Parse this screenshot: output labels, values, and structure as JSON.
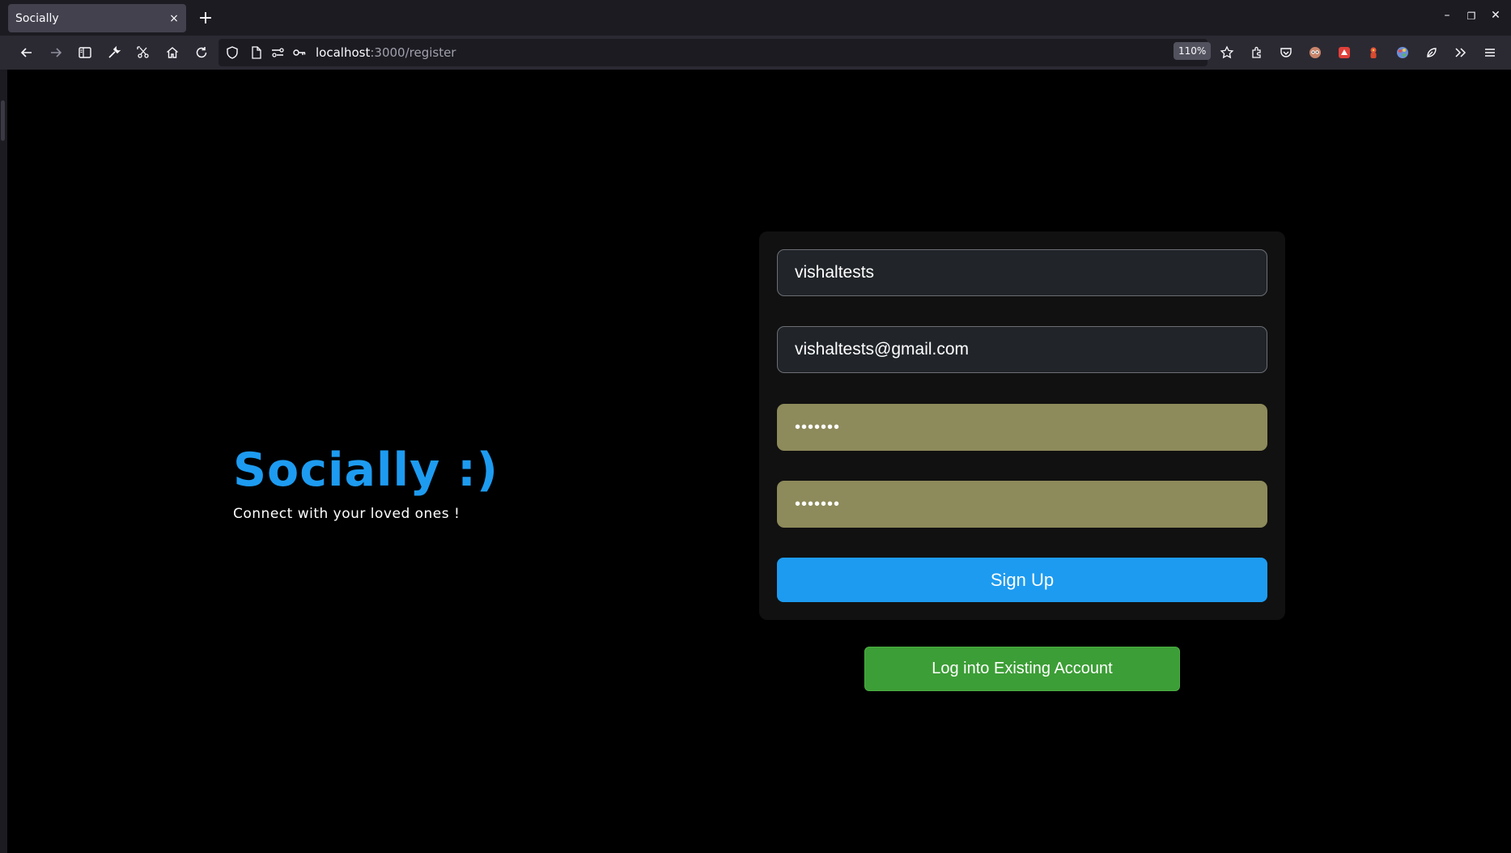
{
  "browser": {
    "tab_title": "Socially",
    "tab_close": "×",
    "new_tab": "+",
    "window_controls": {
      "minimize": "–",
      "restore": "❐",
      "close": "✕"
    },
    "url_host": "localhost",
    "url_rest": ":3000/register",
    "zoom": "110%",
    "icons": [
      "back-icon",
      "forward-icon",
      "sidebar-icon",
      "wrench-icon",
      "screenshot-icon",
      "home-icon",
      "reload-icon",
      "shield-icon",
      "page-icon",
      "permissions-icon",
      "key-icon",
      "star-icon",
      "extensions-icon",
      "pocket-icon",
      "overflow-icon",
      "menu-icon"
    ]
  },
  "hero": {
    "title": "Socially :)",
    "tagline": "Connect with your loved ones !"
  },
  "form": {
    "username_value": "vishaltests",
    "email_value": "vishaltests@gmail.com",
    "password_value": "•••••••",
    "confirm_password_value": "•••••••",
    "signup_label": "Sign Up"
  },
  "login_label": "Log into Existing Account",
  "colors": {
    "brand": "#1d9bf0",
    "login_button": "#3c9e36",
    "autofill": "#8d8a5b"
  }
}
